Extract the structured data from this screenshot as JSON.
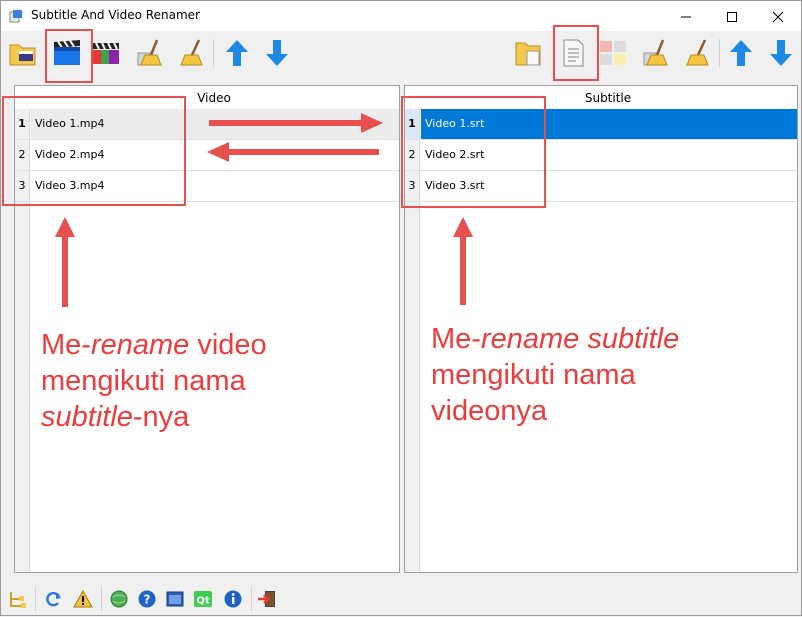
{
  "window": {
    "title": "Subtitle And Video Renamer"
  },
  "video_panel": {
    "header": "Video",
    "rows": [
      {
        "num": "1",
        "name": "Video 1.mp4"
      },
      {
        "num": "2",
        "name": "Video 2.mp4"
      },
      {
        "num": "3",
        "name": "Video 3.mp4"
      }
    ]
  },
  "subtitle_panel": {
    "header": "Subtitle",
    "rows": [
      {
        "num": "1",
        "name": "Video 1.srt"
      },
      {
        "num": "2",
        "name": "Video 2.srt"
      },
      {
        "num": "3",
        "name": "Video 3.srt"
      }
    ]
  },
  "annotations": {
    "left": {
      "l1a": "Me-",
      "l1b": "rename",
      "l1c": " video",
      "l2": "mengikuti nama",
      "l3a": "subtitle",
      "l3b": "-nya"
    },
    "right": {
      "l1a": "Me-",
      "l1b": "rename subtitle",
      "l2": "mengikuti nama",
      "l3": "videonya"
    }
  },
  "colors": {
    "accent": "#0078d7",
    "annotation": "#ee3b3b"
  }
}
